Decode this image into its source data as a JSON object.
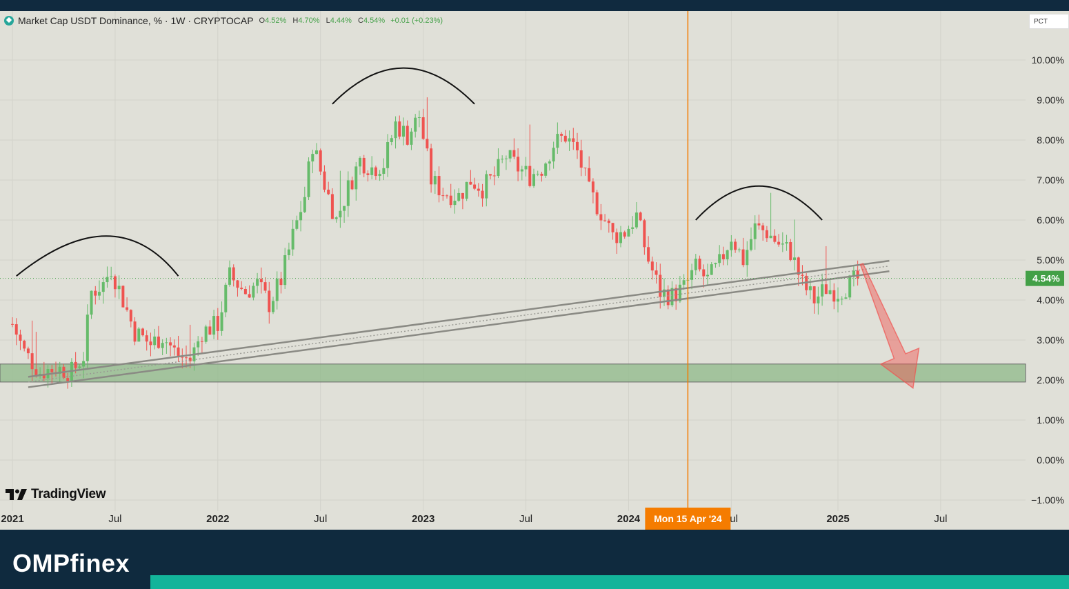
{
  "legend": {
    "symbol_icon": "tether-diamond-icon",
    "title": "Market Cap USDT Dominance, % · 1W · CRYPTOCAP",
    "o_label": "O",
    "o_value": "4.52%",
    "h_label": "H",
    "h_value": "4.70%",
    "l_label": "L",
    "l_value": "4.44%",
    "c_label": "C",
    "c_value": "4.54%",
    "change": "+0.01 (+0.23%)"
  },
  "scale_mode": "PCT",
  "branding": {
    "tradingview": "TradingView",
    "site": "OMPfinex"
  },
  "colors": {
    "up": "#66bb6a",
    "down": "#ef5350",
    "price_label": "#43a047",
    "crosshair": "#f57c00",
    "zone": "#8fb98a",
    "footer_bg": "#0f2a3e",
    "footer_accent": "#13b49a"
  },
  "chart_data": {
    "type": "candlestick",
    "title": "Market Cap USDT Dominance, % · 1W · CRYPTOCAP",
    "timeframe": "1W",
    "ylim": [
      -1.0,
      10.5
    ],
    "y_ticks": [
      "10.00%",
      "9.00%",
      "8.00%",
      "7.00%",
      "6.00%",
      "5.00%",
      "4.00%",
      "3.00%",
      "2.00%",
      "1.00%",
      "0.00%",
      "−1.00%"
    ],
    "x_ticks": [
      "2021",
      "Jul",
      "2022",
      "Jul",
      "2023",
      "Jul",
      "2024",
      "Jul",
      "2025",
      "Jul"
    ],
    "current_price_label": "4.54%",
    "crosshair_date_label": "Mon 15 Apr '24",
    "crosshair_date": "2024-04-15",
    "weekly_close_path": [
      [
        "2021-01-04",
        3.4
      ],
      [
        "2021-01-25",
        2.7
      ],
      [
        "2021-02-22",
        2.2
      ],
      [
        "2021-03-22",
        2.3
      ],
      [
        "2021-04-19",
        2.2
      ],
      [
        "2021-05-10",
        2.6
      ],
      [
        "2021-05-24",
        4.2
      ],
      [
        "2021-06-14",
        4.4
      ],
      [
        "2021-06-28",
        4.8
      ],
      [
        "2021-07-19",
        4.0
      ],
      [
        "2021-08-09",
        3.2
      ],
      [
        "2021-09-06",
        2.9
      ],
      [
        "2021-09-27",
        3.1
      ],
      [
        "2021-10-25",
        2.6
      ],
      [
        "2021-11-15",
        2.5
      ],
      [
        "2021-12-06",
        3.2
      ],
      [
        "2022-01-03",
        3.4
      ],
      [
        "2022-01-24",
        4.6
      ],
      [
        "2022-02-21",
        4.2
      ],
      [
        "2022-03-14",
        4.4
      ],
      [
        "2022-04-04",
        3.9
      ],
      [
        "2022-04-25",
        4.5
      ],
      [
        "2022-05-16",
        5.6
      ],
      [
        "2022-06-06",
        6.6
      ],
      [
        "2022-06-20",
        7.9
      ],
      [
        "2022-07-11",
        6.9
      ],
      [
        "2022-08-01",
        6.0
      ],
      [
        "2022-08-22",
        6.8
      ],
      [
        "2022-09-12",
        7.5
      ],
      [
        "2022-10-03",
        7.3
      ],
      [
        "2022-10-24",
        7.4
      ],
      [
        "2022-11-14",
        8.4
      ],
      [
        "2022-12-05",
        8.1
      ],
      [
        "2022-12-26",
        8.6
      ],
      [
        "2023-01-16",
        7.0
      ],
      [
        "2023-02-06",
        6.7
      ],
      [
        "2023-03-06",
        6.6
      ],
      [
        "2023-03-27",
        7.0
      ],
      [
        "2023-04-17",
        6.8
      ],
      [
        "2023-05-08",
        7.1
      ],
      [
        "2023-05-29",
        7.6
      ],
      [
        "2023-06-19",
        7.3
      ],
      [
        "2023-07-10",
        7.1
      ],
      [
        "2023-07-31",
        7.3
      ],
      [
        "2023-08-21",
        7.9
      ],
      [
        "2023-09-11",
        8.1
      ],
      [
        "2023-10-02",
        7.7
      ],
      [
        "2023-10-23",
        6.7
      ],
      [
        "2023-11-13",
        6.2
      ],
      [
        "2023-12-04",
        5.6
      ],
      [
        "2023-12-25",
        5.7
      ],
      [
        "2024-01-15",
        6.1
      ],
      [
        "2024-02-05",
        5.0
      ],
      [
        "2024-02-26",
        4.2
      ],
      [
        "2024-03-18",
        4.1
      ],
      [
        "2024-04-08",
        4.3
      ],
      [
        "2024-04-29",
        4.8
      ],
      [
        "2024-05-20",
        4.5
      ],
      [
        "2024-06-10",
        4.9
      ],
      [
        "2024-07-01",
        5.6
      ],
      [
        "2024-07-22",
        5.0
      ],
      [
        "2024-08-12",
        5.8
      ],
      [
        "2024-09-02",
        5.7
      ],
      [
        "2024-09-23",
        5.4
      ],
      [
        "2024-10-14",
        5.2
      ],
      [
        "2024-11-04",
        4.4
      ],
      [
        "2024-11-25",
        4.0
      ],
      [
        "2024-12-16",
        4.3
      ],
      [
        "2025-01-06",
        4.2
      ],
      [
        "2025-01-27",
        4.4
      ],
      [
        "2025-02-10",
        4.54
      ]
    ],
    "drawings": {
      "support_zone": {
        "from": 1.95,
        "to": 2.4
      },
      "rising_channel": {
        "start": [
          "2021-02-01",
          1.95
        ],
        "end": [
          "2025-04-07",
          4.85
        ],
        "width": 0.13
      },
      "arcs": [
        {
          "from": "2021-01-11",
          "peak": "2021-07-05",
          "to": "2021-10-25",
          "base": 4.6,
          "top": 5.6
        },
        {
          "from": "2022-07-25",
          "peak": "2022-11-28",
          "to": "2023-04-03",
          "base": 8.9,
          "top": 9.8
        },
        {
          "from": "2024-04-29",
          "peak": "2024-08-19",
          "to": "2024-12-09",
          "base": 6.0,
          "top": 6.85
        }
      ],
      "projection_arrow": {
        "from": [
          "2025-02-17",
          4.9
        ],
        "to": [
          "2025-05-19",
          1.8
        ]
      }
    }
  }
}
